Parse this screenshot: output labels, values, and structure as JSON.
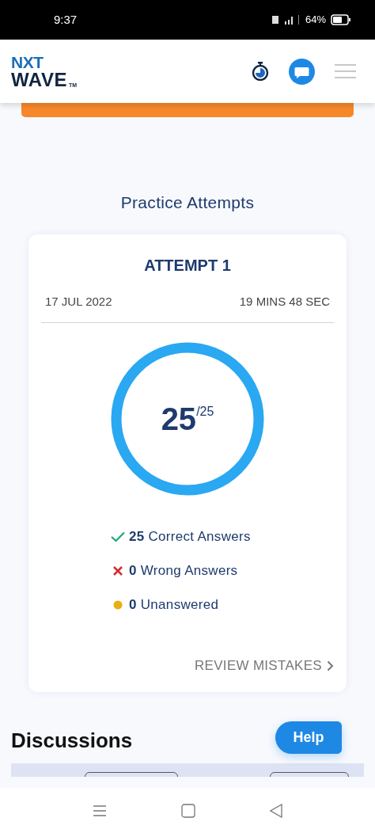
{
  "status_bar": {
    "time": "9:37",
    "battery": "64%"
  },
  "header": {
    "logo_top": "NXT",
    "logo_bottom": "WAVE",
    "logo_mark": "TM"
  },
  "attempts": {
    "title": "Practice Attempts",
    "card": {
      "heading": "ATTEMPT 1",
      "date": "17 JUL 2022",
      "duration": "19 MINS 48 SEC",
      "score": "25",
      "total": "/25",
      "level": 1,
      "stats": [
        {
          "kind": "correct",
          "count": "25",
          "label": "Correct Answers"
        },
        {
          "kind": "wrong",
          "count": "0",
          "label": "Wrong Answers"
        },
        {
          "kind": "unanswered",
          "count": "0",
          "label": "Unanswered"
        }
      ],
      "review": "REVIEW MISTAKES"
    }
  },
  "discussions": {
    "title": "Discussions"
  },
  "help_button": "Help"
}
